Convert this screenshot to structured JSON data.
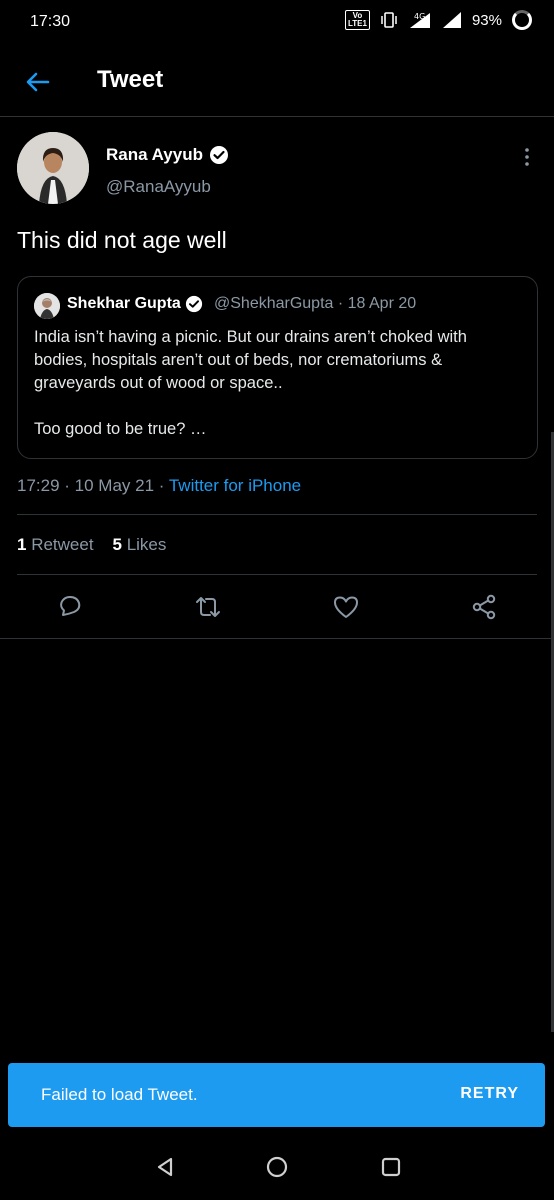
{
  "status_bar": {
    "time": "17:30",
    "volte_label": "Vo\nLTE1",
    "network": "4G",
    "battery": "93%"
  },
  "header": {
    "title": "Tweet",
    "back_icon": "arrow-left-icon"
  },
  "tweet": {
    "author_name": "Rana Ayyub",
    "author_handle": "@RanaAyyub",
    "text": "This did not age well",
    "timestamp": "17:29 · 10 May 21 · ",
    "source": "Twitter for iPhone",
    "retweet_count": "1",
    "retweet_label": "Retweet",
    "like_count": "5",
    "like_label": "Likes"
  },
  "quoted_tweet": {
    "author_name": "Shekhar Gupta",
    "author_handle": "@ShekharGupta · 18 Apr 20",
    "line1": "India isn’t having a picnic. But our drains aren’t choked with bodies, hospitals aren’t out of beds, nor crematoriums & graveyards out of wood or space..",
    "line2": "Too good to be true? …"
  },
  "actions": [
    "reply-icon",
    "retweet-icon",
    "like-icon",
    "share-icon"
  ],
  "snackbar": {
    "message": "Failed to load Tweet.",
    "action": "RETRY"
  },
  "colors": {
    "accent": "#1d9bf0",
    "background": "#000000",
    "muted": "#8b98a5",
    "border": "#2f3336"
  }
}
